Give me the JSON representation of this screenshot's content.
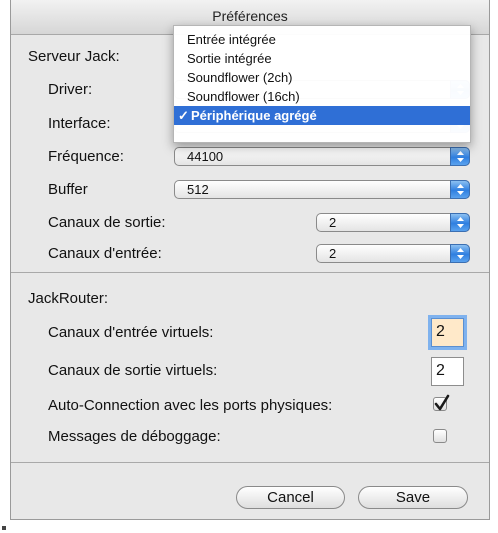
{
  "window": {
    "title": "Préférences"
  },
  "jack": {
    "section_label": "Serveur Jack:",
    "driver_label": "Driver:",
    "interface_label": "Interface:",
    "frequency_label": "Fréquence:",
    "frequency_value": "44100",
    "buffer_label": "Buffer",
    "buffer_value": "512",
    "out_channels_label": "Canaux de sortie:",
    "out_channels_value": "2",
    "in_channels_label": "Canaux d'entrée:",
    "in_channels_value": "2"
  },
  "router": {
    "section_label": "JackRouter:",
    "virtual_in_label": "Canaux d'entrée virtuels:",
    "virtual_in_value": "2",
    "virtual_out_label": "Canaux de sortie virtuels:",
    "virtual_out_value": "2",
    "autoconnect_label": "Auto-Connection avec les ports physiques:",
    "autoconnect_checked": true,
    "debug_label": "Messages de déboggage:",
    "debug_checked": false
  },
  "dropdown_menu": {
    "items": [
      {
        "label": "Entrée intégrée",
        "selected": false
      },
      {
        "label": "Sortie intégrée",
        "selected": false
      },
      {
        "label": "Soundflower (2ch)",
        "selected": false
      },
      {
        "label": "Soundflower (16ch)",
        "selected": false
      },
      {
        "label": "Périphérique agrégé",
        "selected": true
      }
    ],
    "check_mark": "✓"
  },
  "buttons": {
    "cancel": "Cancel",
    "save": "Save"
  },
  "colors": {
    "accent": "#2f6fd6",
    "window_bg": "#e8e8e8",
    "popup_arrow": "#2f7fe0"
  }
}
